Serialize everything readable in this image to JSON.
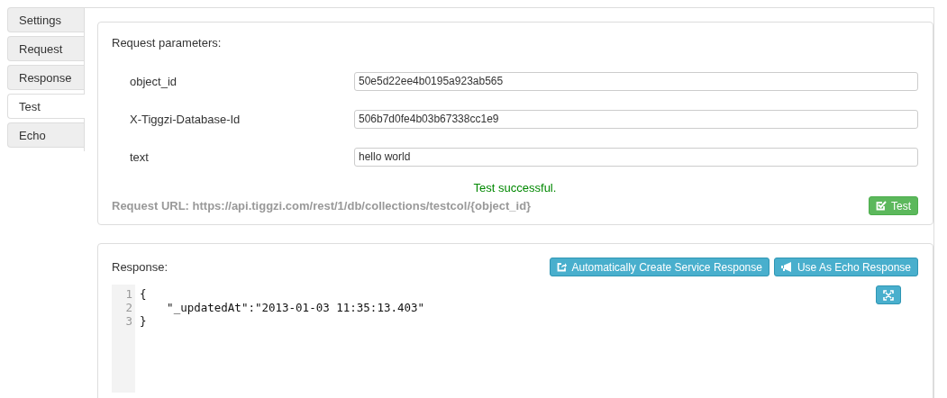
{
  "tabs": [
    {
      "label": "Settings",
      "selected": false
    },
    {
      "label": "Request",
      "selected": false
    },
    {
      "label": "Response",
      "selected": false
    },
    {
      "label": "Test",
      "selected": true
    },
    {
      "label": "Echo",
      "selected": false
    }
  ],
  "request": {
    "heading": "Request parameters:",
    "params": [
      {
        "name": "object_id",
        "value": "50e5d22ee4b0195a923ab565"
      },
      {
        "name": "X-Tiggzi-Database-Id",
        "value": "506b7d0fe4b03b67338cc1e9"
      },
      {
        "name": "text",
        "value": "hello world"
      }
    ],
    "status": "Test successful.",
    "request_url": "Request URL: https://api.tiggzi.com/rest/1/db/collections/testcol/{object_id}",
    "test_button": "Test"
  },
  "response": {
    "heading": "Response:",
    "buttons": [
      "Automatically Create Service Response",
      "Use As Echo Response"
    ],
    "code_lines": [
      {
        "number": "1",
        "text": "{"
      },
      {
        "number": "2",
        "text": "    \"_updatedAt\":\"2013-01-03 11:35:13.403\""
      },
      {
        "number": "3",
        "text": "}"
      }
    ]
  }
}
